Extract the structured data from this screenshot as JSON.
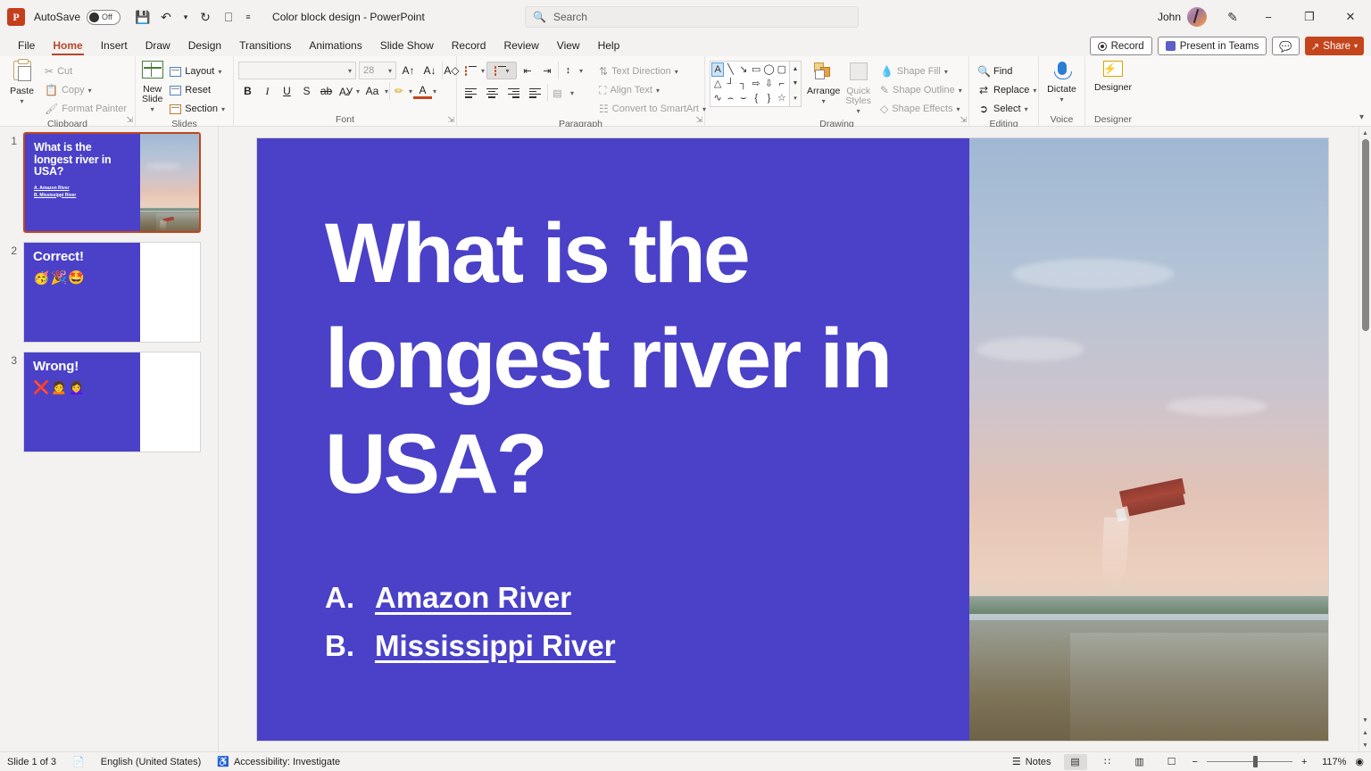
{
  "titlebar": {
    "app_icon": "powerpoint-logo",
    "logo_letter": "P",
    "autosave_label": "AutoSave",
    "autosave_state": "Off",
    "save_icon": "save-icon",
    "undo_icon": "undo-icon",
    "redo_icon": "redo-icon",
    "start_presentation_icon": "start-presentation-icon",
    "customize_qat_icon": "customize-quick-access-toolbar-icon",
    "document_title": "Color block design  -  PowerPoint",
    "user_name": "John",
    "pen_icon": "pen-icon",
    "minimize": "−",
    "restore": "❐",
    "close": "✕"
  },
  "search": {
    "placeholder": "Search",
    "icon": "search-icon"
  },
  "tabs": [
    {
      "label": "File",
      "active": false
    },
    {
      "label": "Home",
      "active": true
    },
    {
      "label": "Insert",
      "active": false
    },
    {
      "label": "Draw",
      "active": false
    },
    {
      "label": "Design",
      "active": false
    },
    {
      "label": "Transitions",
      "active": false
    },
    {
      "label": "Animations",
      "active": false
    },
    {
      "label": "Slide Show",
      "active": false
    },
    {
      "label": "Record",
      "active": false
    },
    {
      "label": "Review",
      "active": false
    },
    {
      "label": "View",
      "active": false
    },
    {
      "label": "Help",
      "active": false
    }
  ],
  "tab_actions": {
    "record": "Record",
    "present_in_teams": "Present in Teams",
    "comments": "comments-icon",
    "share": "Share"
  },
  "ribbon": {
    "collapse_icon": "collapse-ribbon-icon",
    "groups": [
      {
        "name": "Clipboard",
        "label": "Clipboard",
        "paste": "Paste",
        "items": [
          {
            "label": "Cut",
            "icon": "scissors-icon",
            "disabled": true
          },
          {
            "label": "Copy",
            "icon": "copy-icon",
            "disabled": true
          },
          {
            "label": "Format Painter",
            "icon": "format-painter-icon",
            "disabled": true
          }
        ]
      },
      {
        "name": "Slides",
        "label": "Slides",
        "new_slide": "New Slide",
        "items": [
          {
            "label": "Layout",
            "icon": "layout-icon"
          },
          {
            "label": "Reset",
            "icon": "reset-icon"
          },
          {
            "label": "Section",
            "icon": "section-icon"
          }
        ]
      },
      {
        "name": "Font",
        "label": "Font",
        "font_name_value": "",
        "font_size_value": "28",
        "buttons": [
          "Increase Font Size",
          "Decrease Font Size",
          "Clear All Formatting",
          "Bold",
          "Italic",
          "Underline",
          "Text Shadow",
          "Strikethrough",
          "Character Spacing",
          "Change Case",
          "Text Highlight Color",
          "Font Color"
        ]
      },
      {
        "name": "Paragraph",
        "label": "Paragraph",
        "items": [
          {
            "label": "Text Direction",
            "icon": "text-direction-icon",
            "disabled": true
          },
          {
            "label": "Align Text",
            "icon": "align-text-icon",
            "disabled": true
          },
          {
            "label": "Convert to SmartArt",
            "icon": "smartart-icon",
            "disabled": true
          }
        ]
      },
      {
        "name": "Drawing",
        "label": "Drawing",
        "arrange": "Arrange",
        "quick_styles": "Quick Styles",
        "items": [
          {
            "label": "Shape Fill",
            "icon": "shape-fill-icon",
            "disabled": true
          },
          {
            "label": "Shape Outline",
            "icon": "shape-outline-icon",
            "disabled": true
          },
          {
            "label": "Shape Effects",
            "icon": "shape-effects-icon",
            "disabled": true
          }
        ],
        "shapes": [
          "A",
          "╲",
          "↘",
          "▭",
          "◯",
          "▢",
          "△",
          "┘",
          "┐",
          "⇨",
          "⇩",
          "⌐",
          "∿",
          "⌢",
          "⌣",
          "{",
          "}",
          "☆"
        ]
      },
      {
        "name": "Editing",
        "label": "Editing",
        "items": [
          {
            "label": "Find",
            "icon": "search-icon"
          },
          {
            "label": "Replace",
            "icon": "replace-icon"
          },
          {
            "label": "Select",
            "icon": "select-cursor-icon"
          }
        ]
      },
      {
        "name": "Voice",
        "label": "Voice",
        "dictate": "Dictate"
      },
      {
        "name": "Designer",
        "label": "Designer",
        "designer": "Designer"
      }
    ]
  },
  "thumbnails": [
    {
      "number": "1",
      "selected": true,
      "title": "What is the longest river in USA?",
      "options": [
        "A.  Amazon River",
        "B.  Mississippi River"
      ],
      "has_photo": true,
      "emoji": ""
    },
    {
      "number": "2",
      "selected": false,
      "title": "Correct!",
      "options": [],
      "has_photo": false,
      "emoji": "🥳🎉🤩"
    },
    {
      "number": "3",
      "selected": false,
      "title": "Wrong!",
      "options": [],
      "has_photo": false,
      "emoji": "❌🙍🙍‍♀️"
    }
  ],
  "slide": {
    "background_color": "#4a41c8",
    "title": "What is the longest river in USA?",
    "options": [
      {
        "letter": "A.",
        "text": "Amazon River"
      },
      {
        "letter": "B.",
        "text": "Mississippi River"
      }
    ],
    "photo_alt": "aerial view of a barge on the Mississippi River at sunset"
  },
  "statusbar": {
    "slide_counter": "Slide 1 of 3",
    "notes_icon": "notes-page-icon",
    "language": "English (United States)",
    "accessibility_icon": "accessibility-icon",
    "accessibility": "Accessibility: Investigate",
    "notes_label": "Notes",
    "views": [
      {
        "name": "normal-view",
        "icon": "▤",
        "active": true
      },
      {
        "name": "slide-sorter-view",
        "icon": "∷",
        "active": false
      },
      {
        "name": "reading-view",
        "icon": "▥",
        "active": false
      },
      {
        "name": "slide-show-view",
        "icon": "☐",
        "active": false
      }
    ],
    "zoom_out": "−",
    "zoom_in": "+",
    "zoom_level": "117%",
    "fit_icon": "fit-to-window-icon"
  }
}
